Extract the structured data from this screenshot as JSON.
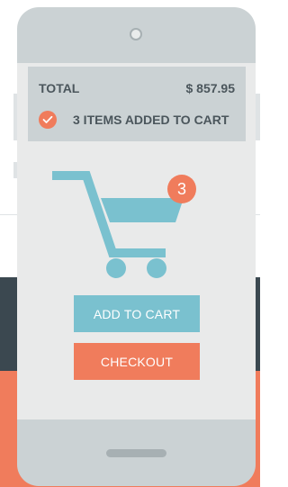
{
  "summary": {
    "total_label": "TOTAL",
    "total_value": "$ 857.95",
    "status_text": "3 ITEMS ADDED TO CART"
  },
  "cart": {
    "badge_count": "3"
  },
  "buttons": {
    "add_to_cart": "ADD TO CART",
    "checkout": "CHECKOUT"
  },
  "icons": {
    "status": "check-icon",
    "cart": "shopping-cart-icon"
  },
  "colors": {
    "accent_orange": "#f07c5c",
    "accent_teal": "#7ac1cf",
    "phone_body": "#cbd2d4",
    "screen_bg": "#e9eaea",
    "text_dark": "#4b565c",
    "dark_band": "#3b4850"
  }
}
